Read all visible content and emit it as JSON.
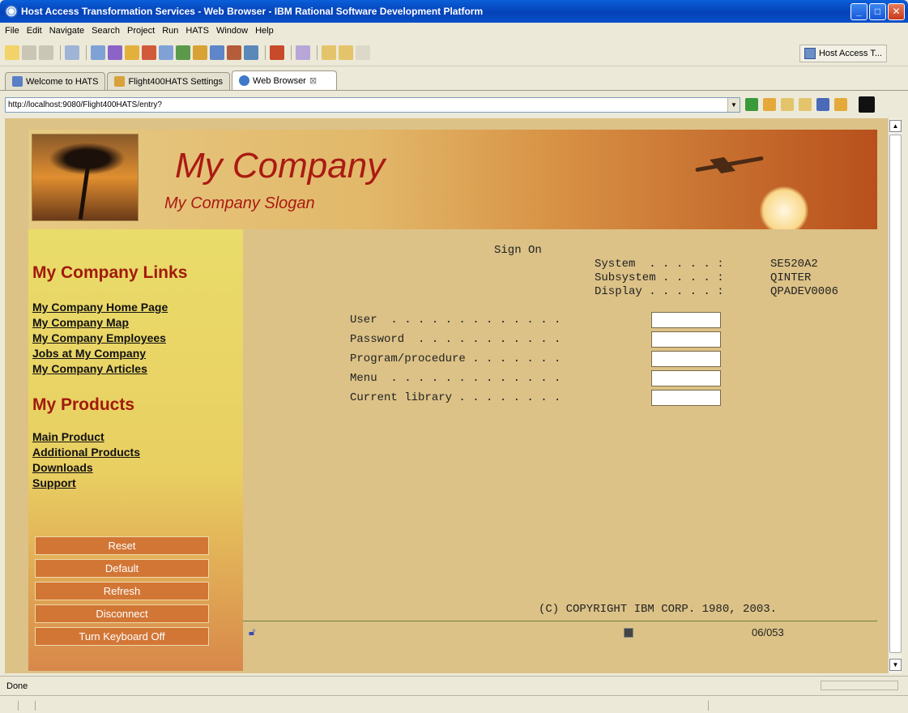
{
  "window": {
    "title": "Host Access Transformation Services - Web Browser - IBM Rational Software Development Platform"
  },
  "menu": [
    "File",
    "Edit",
    "Navigate",
    "Search",
    "Project",
    "Run",
    "HATS",
    "Window",
    "Help"
  ],
  "perspective": {
    "label": "Host Access T..."
  },
  "tabs": [
    {
      "label": "Welcome to HATS"
    },
    {
      "label": "Flight400HATS Settings"
    },
    {
      "label": "Web Browser"
    }
  ],
  "url": {
    "value": "http://localhost:9080/Flight400HATS/entry?"
  },
  "banner": {
    "company": "My Company",
    "slogan": "My Company Slogan"
  },
  "sidebar": {
    "links_heading": "My Company Links",
    "links": [
      "My Company Home Page",
      "My Company Map",
      "My Company Employees",
      "Jobs at My Company",
      "My Company Articles"
    ],
    "products_heading": "My Products",
    "products": [
      "Main Product",
      "Additional Products",
      "Downloads",
      "Support"
    ],
    "buttons": [
      "Reset",
      "Default",
      "Refresh",
      "Disconnect",
      "Turn Keyboard Off"
    ]
  },
  "host": {
    "title": "Sign On",
    "system_info": [
      {
        "label": "System  . . . . . :",
        "value": "SE520A2"
      },
      {
        "label": "Subsystem . . . . :",
        "value": "QINTER"
      },
      {
        "label": "Display . . . . . :",
        "value": "QPADEV0006"
      }
    ],
    "fields": [
      {
        "label": "User  . . . . . . . . . . . . .",
        "value": ""
      },
      {
        "label": "Password  . . . . . . . . . . .",
        "value": ""
      },
      {
        "label": "Program/procedure . . . . . . .",
        "value": ""
      },
      {
        "label": "Menu  . . . . . . . . . . . . .",
        "value": ""
      },
      {
        "label": "Current library . . . . . . . .",
        "value": ""
      }
    ],
    "copyright": "(C) COPYRIGHT IBM CORP. 1980, 2003.",
    "cursor_pos": "06/053"
  },
  "status": {
    "text": "Done"
  },
  "colors": {
    "accent": "#aa1a12",
    "host_bg": "#dcc287",
    "button": "#d27636"
  }
}
